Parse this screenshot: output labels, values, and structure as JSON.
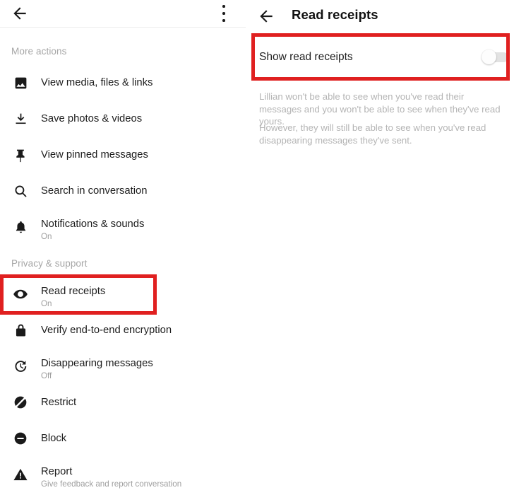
{
  "left_panel": {
    "toolbar": {
      "back_icon": "arrow-back-icon",
      "overflow_icon": "more-vert-icon"
    },
    "sections": [
      {
        "label": "More actions"
      },
      {
        "label": "Privacy & support"
      }
    ],
    "items": [
      {
        "icon": "image-icon",
        "title": "View media, files & links",
        "subtitle": ""
      },
      {
        "icon": "download-icon",
        "title": "Save photos & videos",
        "subtitle": ""
      },
      {
        "icon": "pin-icon",
        "title": "View pinned messages",
        "subtitle": ""
      },
      {
        "icon": "search-icon",
        "title": "Search in conversation",
        "subtitle": ""
      },
      {
        "icon": "bell-icon",
        "title": "Notifications & sounds",
        "subtitle": "On"
      },
      {
        "icon": "eye-icon",
        "title": "Read receipts",
        "subtitle": "On"
      },
      {
        "icon": "lock-icon",
        "title": "Verify end-to-end encryption",
        "subtitle": ""
      },
      {
        "icon": "history-clock-icon",
        "title": "Disappearing messages",
        "subtitle": "Off"
      },
      {
        "icon": "restrict-icon",
        "title": "Restrict",
        "subtitle": ""
      },
      {
        "icon": "block-icon",
        "title": "Block",
        "subtitle": ""
      },
      {
        "icon": "warning-icon",
        "title": "Report",
        "subtitle": "Give feedback and report conversation"
      }
    ]
  },
  "right_panel": {
    "toolbar": {
      "back_icon": "arrow-back-icon",
      "title": "Read receipts"
    },
    "toggle": {
      "label": "Show read receipts",
      "state": "off"
    },
    "descriptions": [
      "Lillian won't be able to see when you've read their messages and you won't be able to see when they've read yours.",
      "However, they will still be able to see when you've read disappearing messages they've sent."
    ]
  },
  "annotations": {
    "highlight_color": "#e02020",
    "boxes": [
      {
        "target": "read-receipts-row"
      },
      {
        "target": "show-read-receipts-toggle-row"
      }
    ]
  }
}
